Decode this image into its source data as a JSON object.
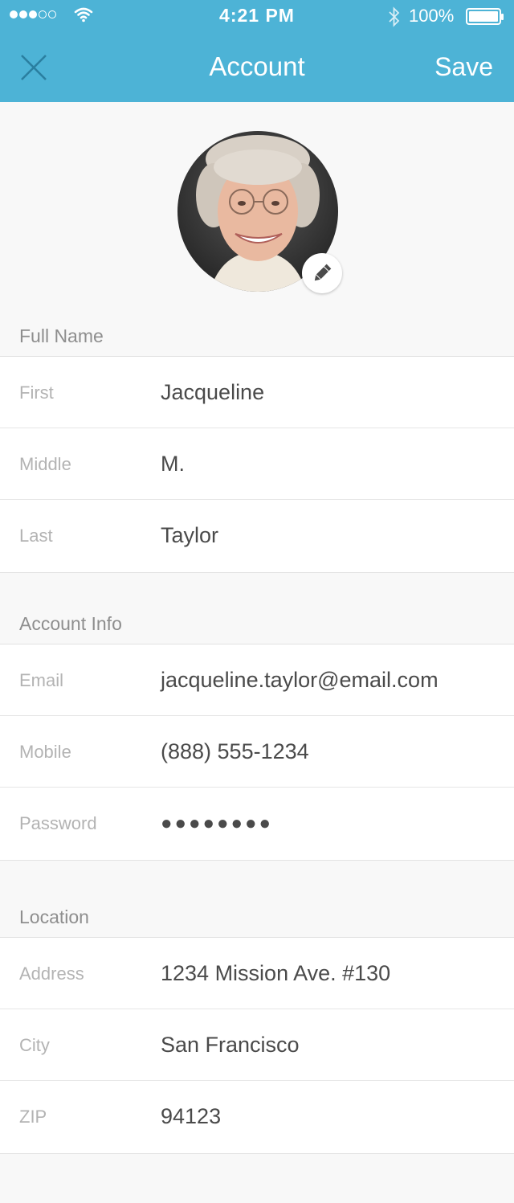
{
  "status_bar": {
    "time": "4:21 PM",
    "battery_percent": "100%",
    "signal_bars_filled": 3,
    "signal_bars_total": 5
  },
  "nav": {
    "title": "Account",
    "save_label": "Save",
    "close_icon": "close-icon"
  },
  "profile": {
    "avatar_icon": "avatar",
    "edit_icon": "pencil-icon"
  },
  "sections": {
    "full_name": {
      "label": "Full Name",
      "rows": [
        {
          "label": "First",
          "value": "Jacqueline"
        },
        {
          "label": "Middle",
          "value": "M."
        },
        {
          "label": "Last",
          "value": "Taylor"
        }
      ]
    },
    "account_info": {
      "label": "Account Info",
      "rows": [
        {
          "label": "Email",
          "value": "jacqueline.taylor@email.com"
        },
        {
          "label": "Mobile",
          "value": "(888) 555-1234"
        },
        {
          "label": "Password",
          "value": "●●●●●●●●"
        }
      ]
    },
    "location": {
      "label": "Location",
      "rows": [
        {
          "label": "Address",
          "value": "1234 Mission Ave. #130"
        },
        {
          "label": "City",
          "value": "San Francisco"
        },
        {
          "label": "ZIP",
          "value": "94123"
        }
      ]
    }
  },
  "colors": {
    "header": "#4db3d6",
    "background": "#f8f8f8",
    "label": "#b3b3b3",
    "value": "#4a4a4a"
  }
}
